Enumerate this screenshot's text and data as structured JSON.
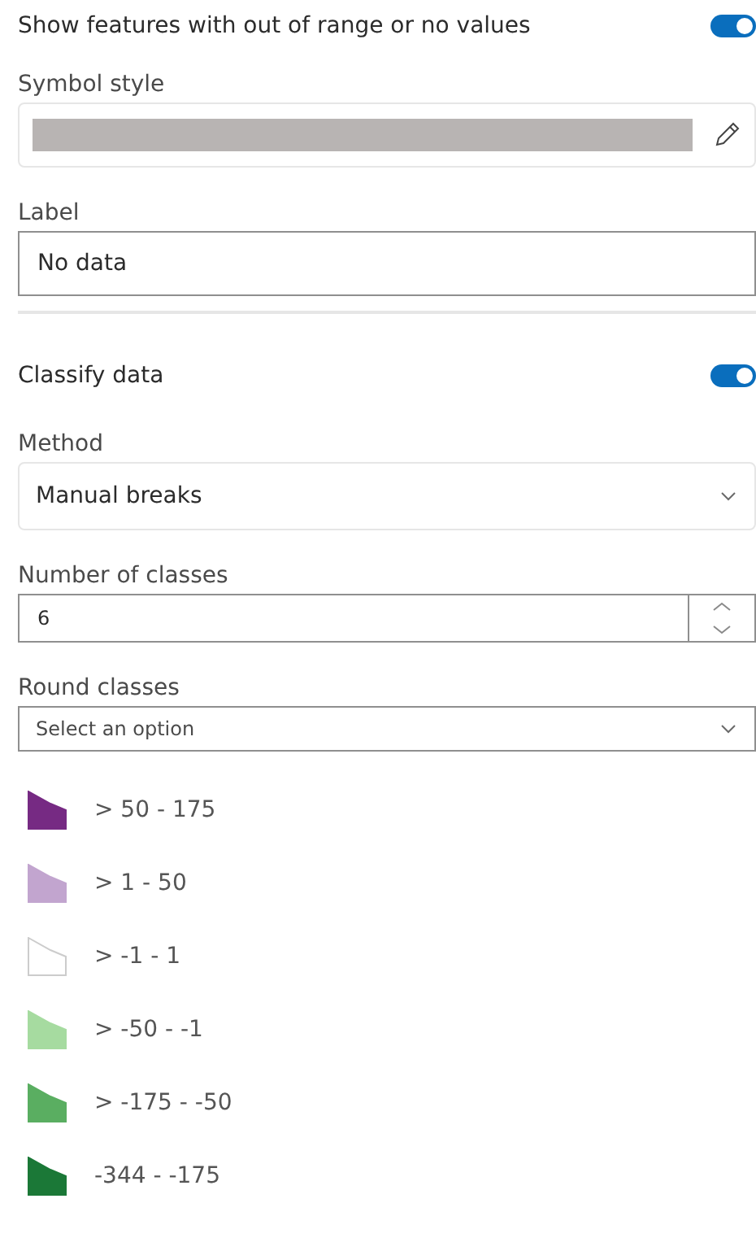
{
  "show_out_of_range": {
    "label": "Show features with out of range or no values",
    "on": true
  },
  "symbol_style": {
    "label": "Symbol style"
  },
  "label_field": {
    "label": "Label",
    "value": "No data"
  },
  "classify": {
    "label": "Classify data",
    "on": true
  },
  "method": {
    "label": "Method",
    "value": "Manual breaks"
  },
  "number_of_classes": {
    "label": "Number of classes",
    "value": "6"
  },
  "round_classes": {
    "label": "Round classes",
    "placeholder": "Select an option"
  },
  "legend": [
    {
      "label": "> 50 - 175",
      "color": "#762a83"
    },
    {
      "label": "> 1 - 50",
      "color": "#c2a5cf"
    },
    {
      "label": "> -1 - 1",
      "color": "#ffffff"
    },
    {
      "label": "> -50 - -1",
      "color": "#a6dba0"
    },
    {
      "label": "> -175 - -50",
      "color": "#5aae61"
    },
    {
      "label": "-344 - -175",
      "color": "#1b7837"
    }
  ]
}
